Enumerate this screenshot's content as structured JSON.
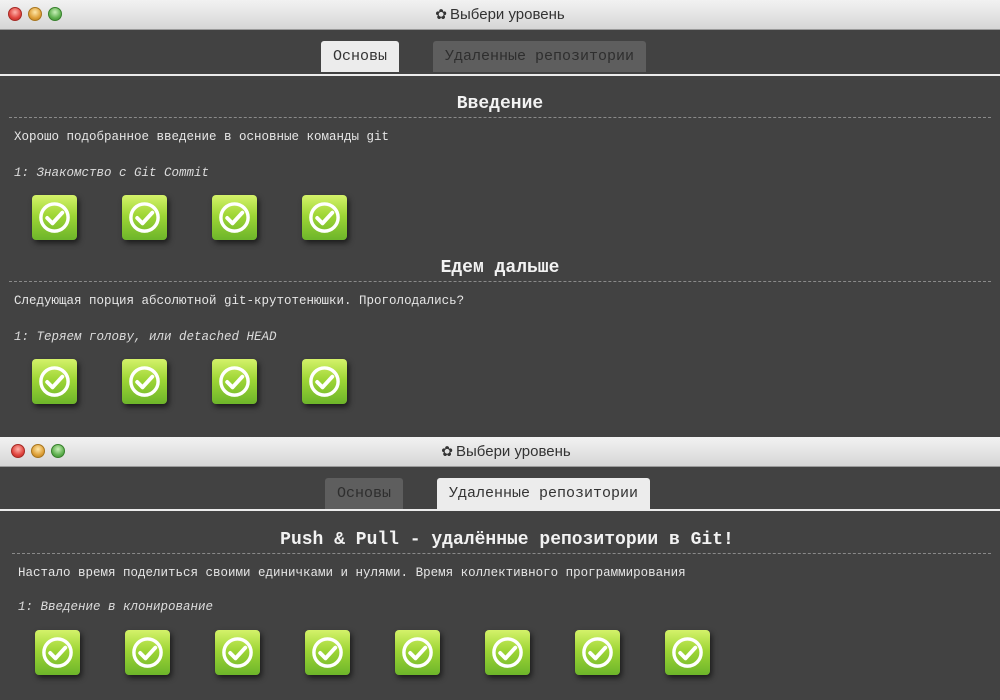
{
  "windows": [
    {
      "title": "Выбери уровень",
      "gear_icon": "gear-icon",
      "tabs": [
        {
          "label": "Основы",
          "active": true
        },
        {
          "label": "Удаленные репозитории",
          "active": false
        }
      ],
      "sections": [
        {
          "title": "Введение",
          "description": "Хорошо подобранное введение в основные команды git",
          "level_label": "1: Знакомство с Git Commit",
          "levels": [
            {
              "completed": true,
              "icon": "checkmark-icon"
            },
            {
              "completed": true,
              "icon": "checkmark-icon"
            },
            {
              "completed": true,
              "icon": "checkmark-icon"
            },
            {
              "completed": true,
              "icon": "checkmark-icon"
            }
          ]
        },
        {
          "title": "Едем дальше",
          "description": "Следующая порция абсолютной git-крутотенюшки. Проголодались?",
          "level_label": "1: Теряем голову, или detached HEAD",
          "levels": [
            {
              "completed": true,
              "icon": "checkmark-icon"
            },
            {
              "completed": true,
              "icon": "checkmark-icon"
            },
            {
              "completed": true,
              "icon": "checkmark-icon"
            },
            {
              "completed": true,
              "icon": "checkmark-icon"
            }
          ]
        }
      ]
    },
    {
      "title": "Выбери уровень",
      "gear_icon": "gear-icon",
      "tabs": [
        {
          "label": "Основы",
          "active": false
        },
        {
          "label": "Удаленные репозитории",
          "active": true
        }
      ],
      "sections": [
        {
          "title": "Push & Pull - удалённые репозитории в Git!",
          "description": "Настало время поделиться своими единичками и нулями. Время коллективного программирования",
          "level_label": "1: Введение в клонирование",
          "levels": [
            {
              "completed": true,
              "icon": "checkmark-icon"
            },
            {
              "completed": true,
              "icon": "checkmark-icon"
            },
            {
              "completed": true,
              "icon": "checkmark-icon"
            },
            {
              "completed": true,
              "icon": "checkmark-icon"
            },
            {
              "completed": true,
              "icon": "checkmark-icon"
            },
            {
              "completed": true,
              "icon": "checkmark-icon"
            },
            {
              "completed": true,
              "icon": "checkmark-icon"
            },
            {
              "completed": true,
              "icon": "checkmark-icon"
            }
          ]
        }
      ]
    }
  ],
  "colors": {
    "background": "#424242",
    "tab_active": "#ececec",
    "tab_inactive": "#5e5e5e",
    "level_complete": "#8cc63e"
  }
}
